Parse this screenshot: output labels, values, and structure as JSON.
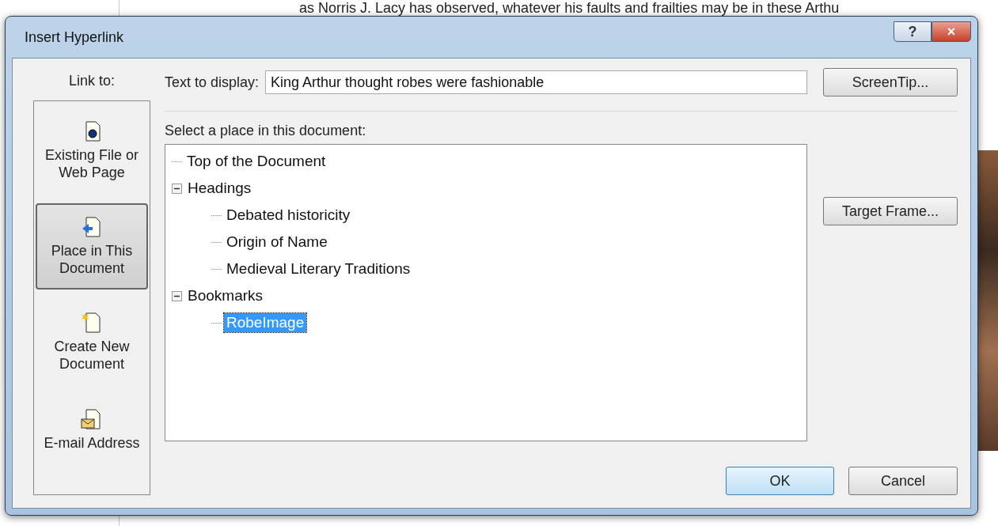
{
  "document": {
    "top_line": "as Norris J. Lacy has observed, whatever his faults and frailties may be in these Arthu"
  },
  "window": {
    "title": "Insert Hyperlink",
    "help": "?",
    "close": "×"
  },
  "link_to": {
    "label": "Link to:",
    "items": [
      {
        "kind": "file",
        "label": "Existing File or Web Page",
        "selected": false
      },
      {
        "kind": "place",
        "label": "Place in This Document",
        "selected": true
      },
      {
        "kind": "new",
        "label": "Create New Document",
        "selected": false
      },
      {
        "kind": "email",
        "label": "E-mail Address",
        "selected": false
      }
    ]
  },
  "text_to_display": {
    "label": "Text to display:",
    "value": "King Arthur thought robes were fashionable"
  },
  "place_label": "Select a place in this document:",
  "tree": [
    {
      "label": "Top of the Document",
      "selected": false
    },
    {
      "label": "Headings",
      "expanded": true,
      "selected": false,
      "children": [
        {
          "label": "Debated historicity",
          "selected": false
        },
        {
          "label": "Origin of Name",
          "selected": false
        },
        {
          "label": "Medieval Literary Traditions",
          "selected": false
        }
      ]
    },
    {
      "label": "Bookmarks",
      "expanded": true,
      "selected": false,
      "children": [
        {
          "label": "RobeImage",
          "selected": true
        }
      ]
    }
  ],
  "buttons": {
    "screentip": "ScreenTip...",
    "target_frame": "Target Frame...",
    "ok": "OK",
    "cancel": "Cancel"
  }
}
